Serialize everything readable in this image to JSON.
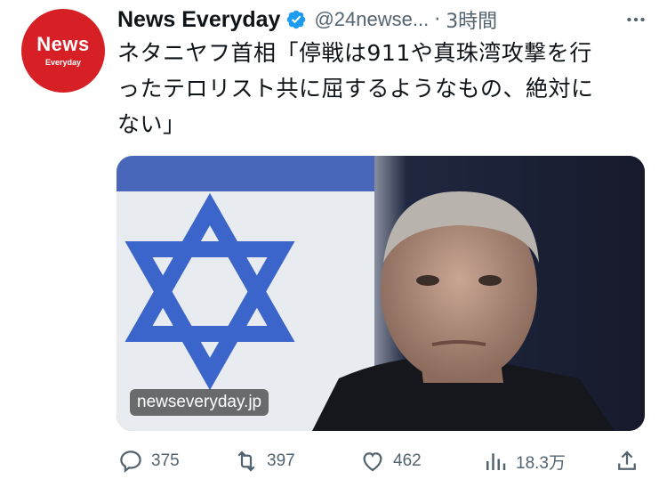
{
  "account": {
    "avatar_text": "News",
    "avatar_subtext": "Everyday",
    "display_name": "News Everyday",
    "handle": "@24newse...",
    "separator": "·",
    "time": "3時間"
  },
  "tweet": {
    "text_line1": "ネタニヤフ首相「停戦は911や真珠湾攻撃を行",
    "text_line2": "ったテロリスト共に屈するようなもの、絶対に",
    "text_line3": "ない」"
  },
  "media": {
    "domain": "newseveryday.jp"
  },
  "actions": {
    "reply_count": "375",
    "retweet_count": "397",
    "like_count": "462",
    "views_count": "18.3万"
  },
  "colors": {
    "brand_red": "#d71f26",
    "verified_blue": "#1d9bf0",
    "muted": "#536471"
  }
}
